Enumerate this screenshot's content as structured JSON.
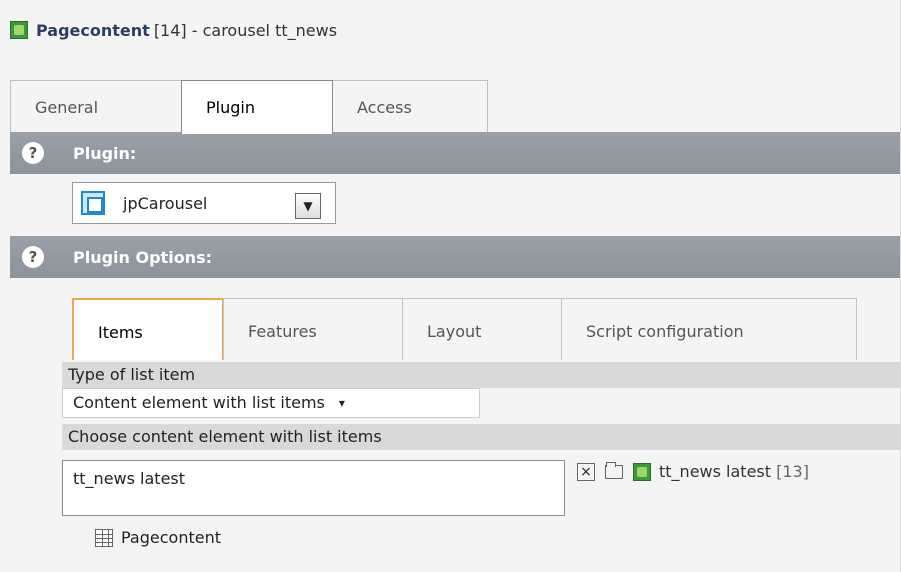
{
  "header": {
    "title_strong": "Pagecontent",
    "title_rest": "[14] - carousel tt_news"
  },
  "tabs": [
    {
      "label": "General",
      "active": false
    },
    {
      "label": "Plugin",
      "active": true
    },
    {
      "label": "Access",
      "active": false
    }
  ],
  "sections": {
    "plugin": {
      "label": "Plugin:"
    },
    "plugin_options": {
      "label": "Plugin Options:"
    }
  },
  "plugin_select": {
    "value": "jpCarousel"
  },
  "sub_tabs": [
    {
      "label": "Items",
      "active": true
    },
    {
      "label": "Features",
      "active": false
    },
    {
      "label": "Layout",
      "active": false
    },
    {
      "label": "Script configuration",
      "active": false
    }
  ],
  "fields": {
    "type_of_list_item": {
      "label": "Type of list item",
      "value": "Content element with list items"
    },
    "choose_content": {
      "label": "Choose content element with list items",
      "value": "tt_news latest"
    }
  },
  "related_record": {
    "label": "tt_news latest",
    "id": "[13]"
  },
  "browser": {
    "label": "Pagecontent"
  },
  "icons": {
    "help": "?",
    "dropdown": "▼",
    "small_arrow": "▾"
  }
}
